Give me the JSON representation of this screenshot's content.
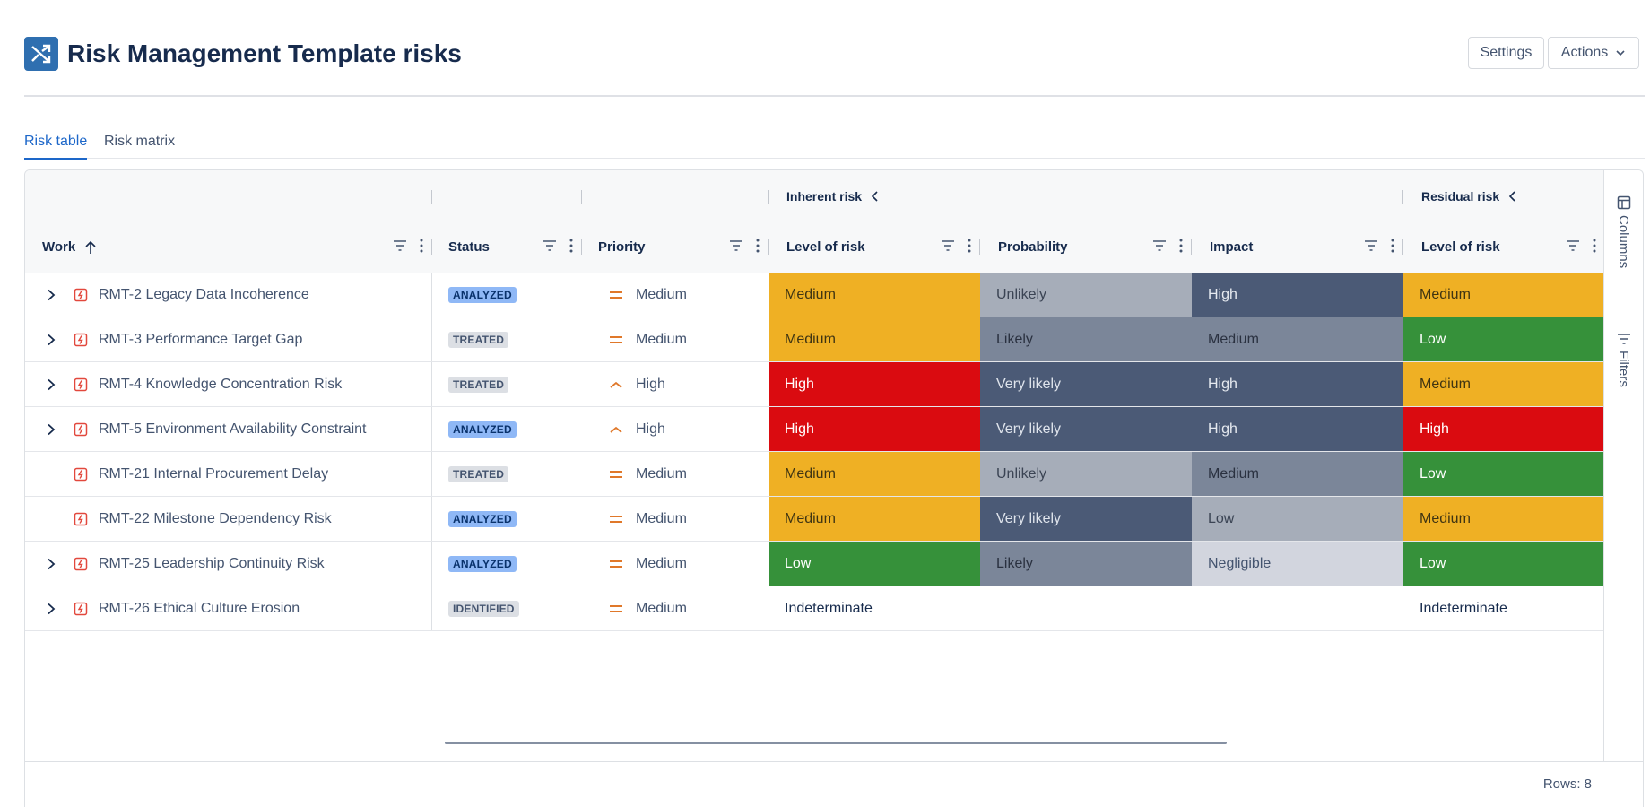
{
  "page": {
    "title": "Risk Management Template risks",
    "settings_label": "Settings",
    "actions_label": "Actions"
  },
  "tabs": [
    {
      "label": "Risk table",
      "active": true
    },
    {
      "label": "Risk matrix",
      "active": false
    }
  ],
  "groups": {
    "inherent": "Inherent risk",
    "residual": "Residual risk"
  },
  "columns": {
    "work": "Work",
    "status": "Status",
    "priority": "Priority",
    "inherent_level": "Level of risk",
    "probability": "Probability",
    "impact": "Impact",
    "residual_level": "Level of risk"
  },
  "side": {
    "columns": "Columns",
    "filters": "Filters"
  },
  "colors": {
    "Medium": {
      "bg": "#efb024",
      "fg": "#3f3412"
    },
    "Low": {
      "bg": "#36913a",
      "fg": "#ffffff"
    },
    "High": {
      "bg": "#da0b10",
      "fg": "#ffffff"
    },
    "Unlikely": {
      "bg": "#a6adb9",
      "fg": "#3b4454"
    },
    "Likely": {
      "bg": "#7b8699",
      "fg": "#2a3140"
    },
    "Very likely": {
      "bg": "#4b5a76",
      "fg": "#dfe4ec"
    },
    "Impact-High": {
      "bg": "#4b5a76",
      "fg": "#e6eaf0"
    },
    "Impact-Medium": {
      "bg": "#7b8699",
      "fg": "#2a3140"
    },
    "Impact-Low": {
      "bg": "#a6adb9",
      "fg": "#3b4454"
    },
    "Negligible": {
      "bg": "#d2d5de",
      "fg": "#44546f"
    }
  },
  "rows": [
    {
      "key": "RMT-2",
      "summary": "Legacy Data Incoherence",
      "expandable": true,
      "status": "ANALYZED",
      "priority": "Medium",
      "inherent_level": "Medium",
      "probability": "Unlikely",
      "impact": "High",
      "residual_level": "Medium"
    },
    {
      "key": "RMT-3",
      "summary": "Performance Target Gap",
      "expandable": true,
      "status": "TREATED",
      "priority": "Medium",
      "inherent_level": "Medium",
      "probability": "Likely",
      "impact": "Medium",
      "residual_level": "Low"
    },
    {
      "key": "RMT-4",
      "summary": "Knowledge Concentration Risk",
      "expandable": true,
      "status": "TREATED",
      "priority": "High",
      "inherent_level": "High",
      "probability": "Very likely",
      "impact": "High",
      "residual_level": "Medium"
    },
    {
      "key": "RMT-5",
      "summary": "Environment Availability Constraint",
      "expandable": true,
      "status": "ANALYZED",
      "priority": "High",
      "inherent_level": "High",
      "probability": "Very likely",
      "impact": "High",
      "residual_level": "High"
    },
    {
      "key": "RMT-21",
      "summary": "Internal Procurement Delay",
      "expandable": false,
      "status": "TREATED",
      "priority": "Medium",
      "inherent_level": "Medium",
      "probability": "Unlikely",
      "impact": "Medium",
      "residual_level": "Low"
    },
    {
      "key": "RMT-22",
      "summary": "Milestone Dependency Risk",
      "expandable": false,
      "status": "ANALYZED",
      "priority": "Medium",
      "inherent_level": "Medium",
      "probability": "Very likely",
      "impact": "Low",
      "residual_level": "Medium"
    },
    {
      "key": "RMT-25",
      "summary": "Leadership Continuity Risk",
      "expandable": true,
      "status": "ANALYZED",
      "priority": "Medium",
      "inherent_level": "Low",
      "probability": "Likely",
      "impact": "Negligible",
      "residual_level": "Low"
    },
    {
      "key": "RMT-26",
      "summary": "Ethical Culture Erosion",
      "expandable": true,
      "status": "IDENTIFIED",
      "priority": "Medium",
      "inherent_level": "Indeterminate",
      "probability": "",
      "impact": "",
      "residual_level": "Indeterminate"
    }
  ],
  "footer": {
    "rows_label": "Rows: 8"
  }
}
